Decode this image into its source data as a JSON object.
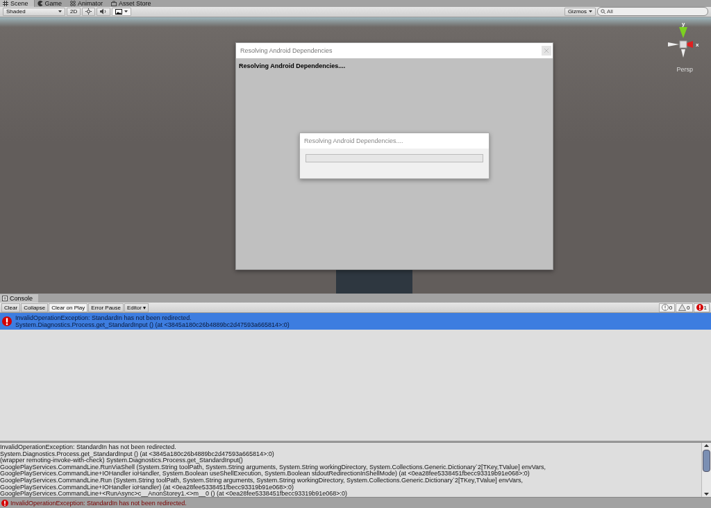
{
  "tabs": [
    {
      "label": "Scene",
      "selected": true
    },
    {
      "label": "Game",
      "selected": false
    },
    {
      "label": "Animator",
      "selected": false
    },
    {
      "label": "Asset Store",
      "selected": false
    }
  ],
  "scene_toolbar": {
    "shading": "Shaded",
    "mode_2d": "2D",
    "gizmos": "Gizmos",
    "search": {
      "value": "All"
    }
  },
  "scene": {
    "projection": "Persp",
    "axis_y": "y",
    "axis_x": "x"
  },
  "dialog": {
    "title": "Resolving Android Dependencies",
    "heading": "Resolving Android Dependencies....",
    "progress": {
      "title": "Resolving Android Dependencies....",
      "level": 0
    }
  },
  "console": {
    "tab": "Console",
    "buttons": [
      {
        "label": "Clear",
        "selected": false
      },
      {
        "label": "Collapse",
        "selected": false
      },
      {
        "label": "Clear on Play",
        "selected": true
      },
      {
        "label": "Error Pause",
        "selected": false
      },
      {
        "label": "Editor ▾",
        "selected": false
      }
    ],
    "counters": [
      {
        "kind": "info",
        "count": "0"
      },
      {
        "kind": "warning",
        "count": "0"
      },
      {
        "kind": "error",
        "count": "1"
      }
    ],
    "entries": [
      {
        "kind": "error",
        "selected": true,
        "lines": [
          "InvalidOperationException: StandardIn has not been redirected.",
          "System.Diagnostics.Process.get_StandardInput () (at <3845a180c26b4889bc2d47593a665814>:0)"
        ]
      }
    ],
    "detail": [
      "InvalidOperationException: StandardIn has not been redirected.",
      "System.Diagnostics.Process.get_StandardInput () (at <3845a180c26b4889bc2d47593a665814>:0)",
      "(wrapper remoting-invoke-with-check) System.Diagnostics.Process.get_StandardInput()",
      "GooglePlayServices.CommandLine.RunViaShell (System.String toolPath, System.String arguments, System.String workingDirectory, System.Collections.Generic.Dictionary`2[TKey,TValue] envVars,",
      "GooglePlayServices.CommandLine+IOHandler ioHandler, System.Boolean useShellExecution, System.Boolean stdoutRedirectionInShellMode) (at <0ea28fee5338451fbecc93319b91e068>:0)",
      "GooglePlayServices.CommandLine.Run (System.String toolPath, System.String arguments, System.String workingDirectory, System.Collections.Generic.Dictionary`2[TKey,TValue] envVars,",
      "GooglePlayServices.CommandLine+IOHandler ioHandler) (at <0ea28fee5338451fbecc93319b91e068>:0)",
      "GooglePlayServices.CommandLine+<RunAsync>c__AnonStorey1.<>m__0 () (at <0ea28fee5338451fbecc93319b91e068>:0)"
    ],
    "status": {
      "kind": "error",
      "text": "InvalidOperationException: StandardIn has not been redirected."
    }
  }
}
